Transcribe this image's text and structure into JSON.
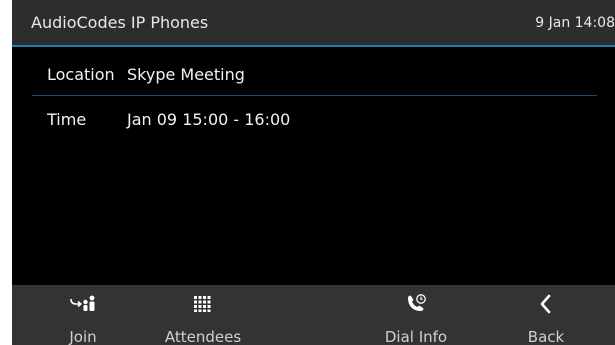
{
  "header": {
    "title": "AudioCodes IP Phones",
    "clock": "9 Jan 14:08"
  },
  "meeting": {
    "location_label": "Location",
    "location_value": "Skype Meeting",
    "time_label": "Time",
    "time_value": "Jan 09 15:00 - 16:00"
  },
  "softkeys": [
    {
      "label": "Join",
      "icon": "join-icon"
    },
    {
      "label": "Attendees",
      "icon": "keypad-icon"
    },
    {
      "label": "Dial Info",
      "icon": "phone-info-icon"
    },
    {
      "label": "Back",
      "icon": "chevron-left-icon"
    }
  ],
  "colors": {
    "screen_bg": "#000000",
    "header_bg": "#2d2d2d",
    "accent": "#1e7eb0",
    "softkey_bg": "#333333",
    "text": "#ffffff"
  }
}
